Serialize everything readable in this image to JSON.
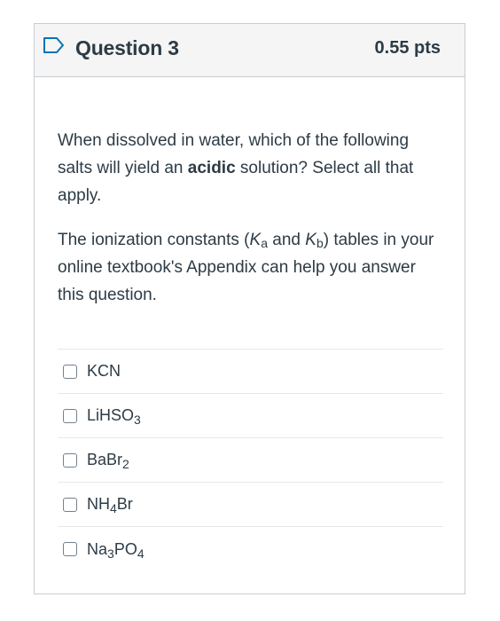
{
  "question": {
    "title": "Question 3",
    "points": "0.55 pts",
    "flag_icon": "bookmark-flag-icon",
    "accent_color": "#0374b5"
  },
  "body": {
    "p1_a": "When dissolved in water, which of the following salts will yield an ",
    "p1_bold": "acidic",
    "p1_b": " solution? Select all that apply.",
    "p2_a": "The ionization constants (",
    "p2_k1": "K",
    "p2_k1_sub": "a",
    "p2_mid": " and ",
    "p2_k2": "K",
    "p2_k2_sub": "b",
    "p2_b": ") tables in your online textbook's Appendix can help you answer this question."
  },
  "answers": [
    {
      "parts": [
        {
          "t": "KCN",
          "sub": false
        }
      ],
      "checked": false
    },
    {
      "parts": [
        {
          "t": "LiHSO",
          "sub": false
        },
        {
          "t": "3",
          "sub": true
        }
      ],
      "checked": false
    },
    {
      "parts": [
        {
          "t": "BaBr",
          "sub": false
        },
        {
          "t": "2",
          "sub": true
        }
      ],
      "checked": false
    },
    {
      "parts": [
        {
          "t": "NH",
          "sub": false
        },
        {
          "t": "4",
          "sub": true
        },
        {
          "t": "Br",
          "sub": false
        }
      ],
      "checked": false
    },
    {
      "parts": [
        {
          "t": "Na",
          "sub": false
        },
        {
          "t": "3",
          "sub": true
        },
        {
          "t": "PO",
          "sub": false
        },
        {
          "t": "4",
          "sub": true
        }
      ],
      "checked": false
    }
  ]
}
